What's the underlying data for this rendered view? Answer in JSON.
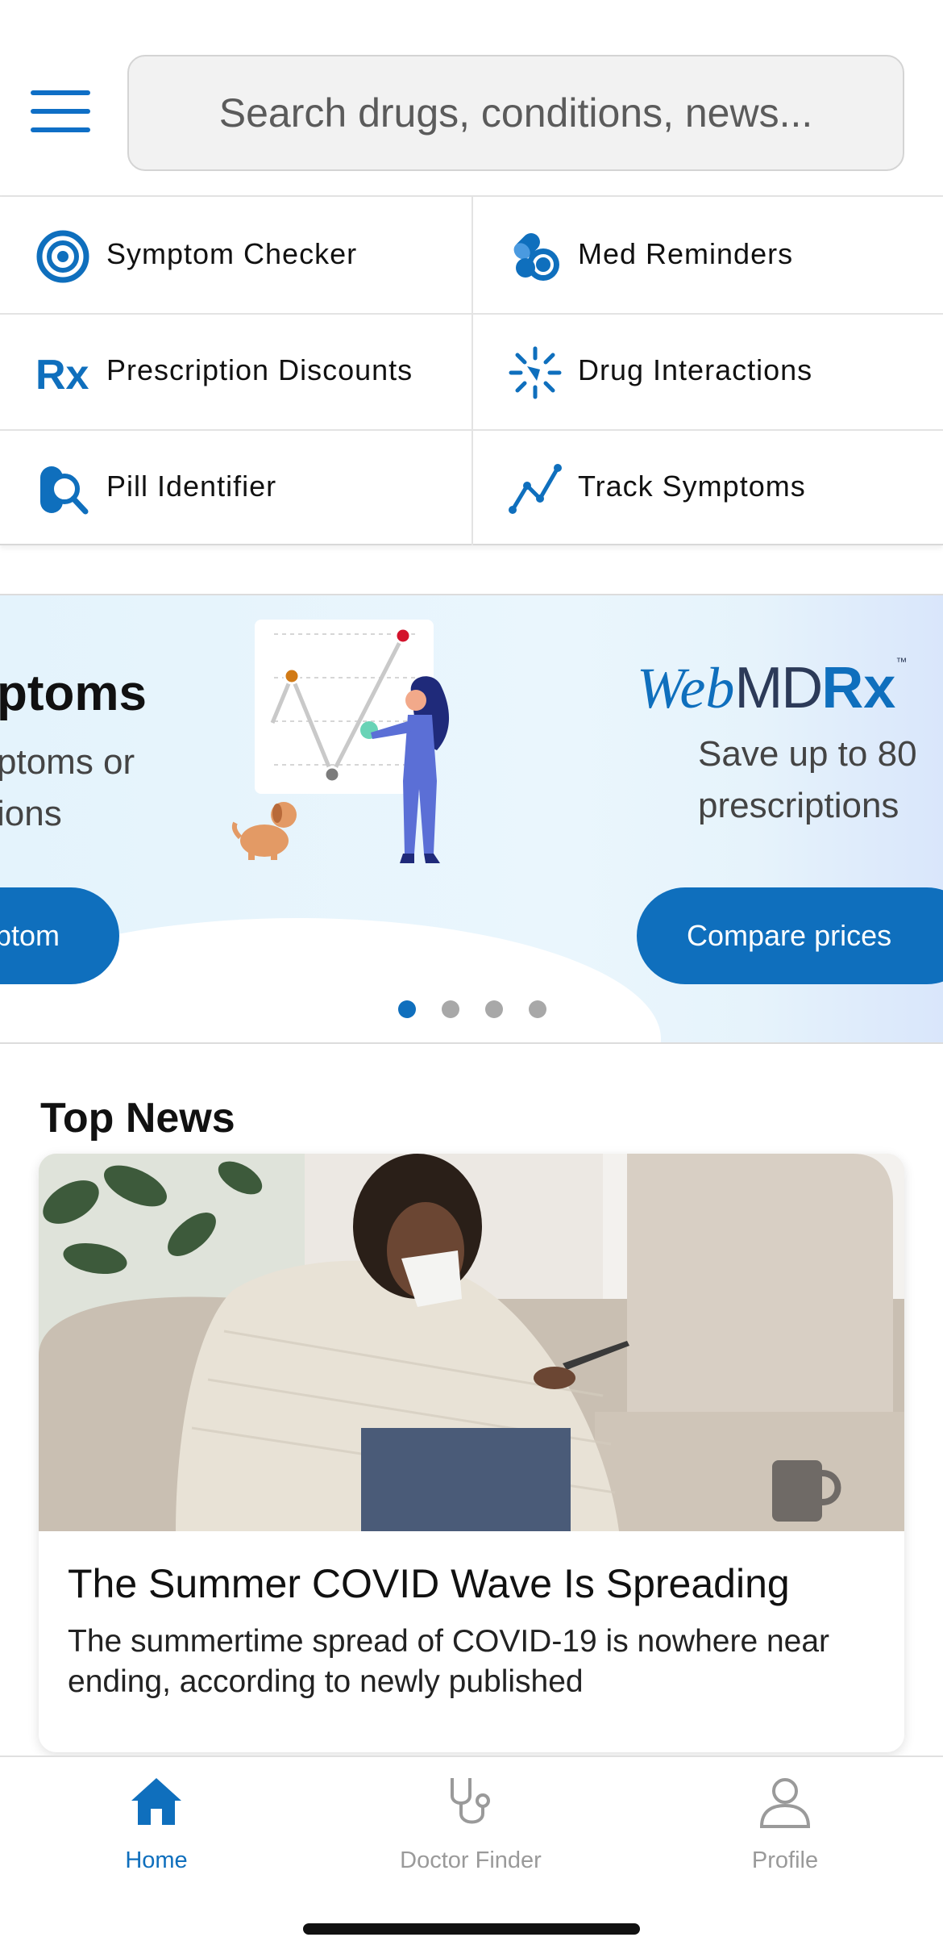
{
  "search": {
    "placeholder": "Search drugs, conditions, news..."
  },
  "quick_links": [
    {
      "label": "Symptom Checker",
      "icon": "target-icon"
    },
    {
      "label": "Med Reminders",
      "icon": "pills-icon"
    },
    {
      "label": "Prescription Discounts",
      "icon": "rx-icon"
    },
    {
      "label": "Drug Interactions",
      "icon": "burst-icon"
    },
    {
      "label": "Pill Identifier",
      "icon": "pill-search-icon"
    },
    {
      "label": "Track Symptoms",
      "icon": "line-chart-icon"
    }
  ],
  "carousel": {
    "slide_left": {
      "title": "ptoms",
      "sub_line1": "ptoms or",
      "sub_line2": "ions",
      "button": "ptom"
    },
    "slide_right": {
      "logo_web": "Web",
      "logo_md": "MD",
      "logo_rx": "Rx",
      "logo_tm": "™",
      "sub_line1": "Save up to 80",
      "sub_line2": "prescriptions",
      "button": "Compare prices"
    },
    "dots": 4,
    "active_dot": 0,
    "colors": {
      "accent": "#0f6fbd",
      "inactive_dot": "#a8a8a8"
    }
  },
  "news": {
    "section_title": "Top News",
    "headline": "The Summer COVID Wave Is Spreading",
    "summary": "The summertime spread of COVID-19 is nowhere near ending, according to newly published"
  },
  "tabbar": {
    "tabs": [
      {
        "label": "Home",
        "icon": "home-icon",
        "active": true
      },
      {
        "label": "Doctor Finder",
        "icon": "stethoscope-icon",
        "active": false
      },
      {
        "label": "Profile",
        "icon": "person-icon",
        "active": false
      }
    ],
    "colors": {
      "active": "#0f6fbd",
      "inactive": "#9a9a9a"
    }
  }
}
